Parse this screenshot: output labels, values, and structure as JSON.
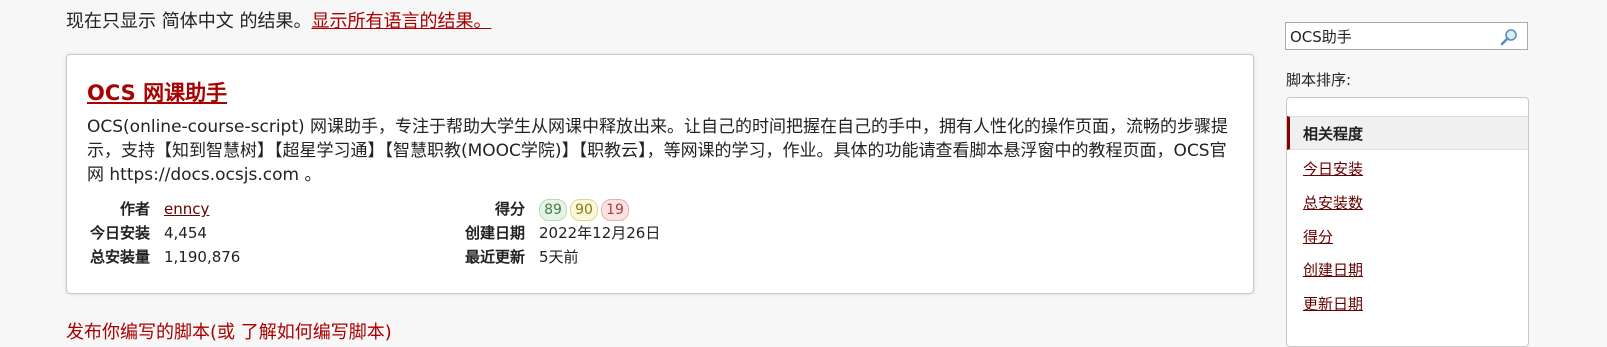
{
  "language_notice": {
    "text": "现在只显示 简体中文 的结果。",
    "link": "显示所有语言的结果。"
  },
  "script": {
    "title": "OCS 网课助手",
    "description": "OCS(online-course-script) 网课助手，专注于帮助大学生从网课中释放出来。让自己的时间把握在自己的手中，拥有人性化的操作页面，流畅的步骤提示，支持【知到智慧树】【超星学习通】【智慧职教(MOOC学院)】【职教云】，等网课的学习，作业。具体的功能请查看脚本悬浮窗中的教程页面，OCS官网 https://docs.ocsjs.com 。",
    "author_label": "作者",
    "author": "enncy",
    "daily_installs_label": "今日安装",
    "daily_installs": "4,454",
    "total_installs_label": "总安装量",
    "total_installs": "1,190,876",
    "score_label": "得分",
    "scores": {
      "good": "89",
      "ok": "90",
      "bad": "19"
    },
    "created_label": "创建日期",
    "created": "2022年12月26日",
    "updated_label": "最近更新",
    "updated": "5天前"
  },
  "bottom_link": "发布你编写的脚本(或 了解如何编写脚本)",
  "search": {
    "value": "OCS助手",
    "icon": "magnifier-icon"
  },
  "sort": {
    "label": "脚本排序:",
    "items": [
      {
        "label": "相关程度",
        "active": true
      },
      {
        "label": "今日安装"
      },
      {
        "label": "总安装数"
      },
      {
        "label": "得分"
      },
      {
        "label": "创建日期"
      },
      {
        "label": "更新日期"
      }
    ]
  },
  "colors": {
    "link": "#670000",
    "title": "#aa0000",
    "active_border": "#880000"
  }
}
